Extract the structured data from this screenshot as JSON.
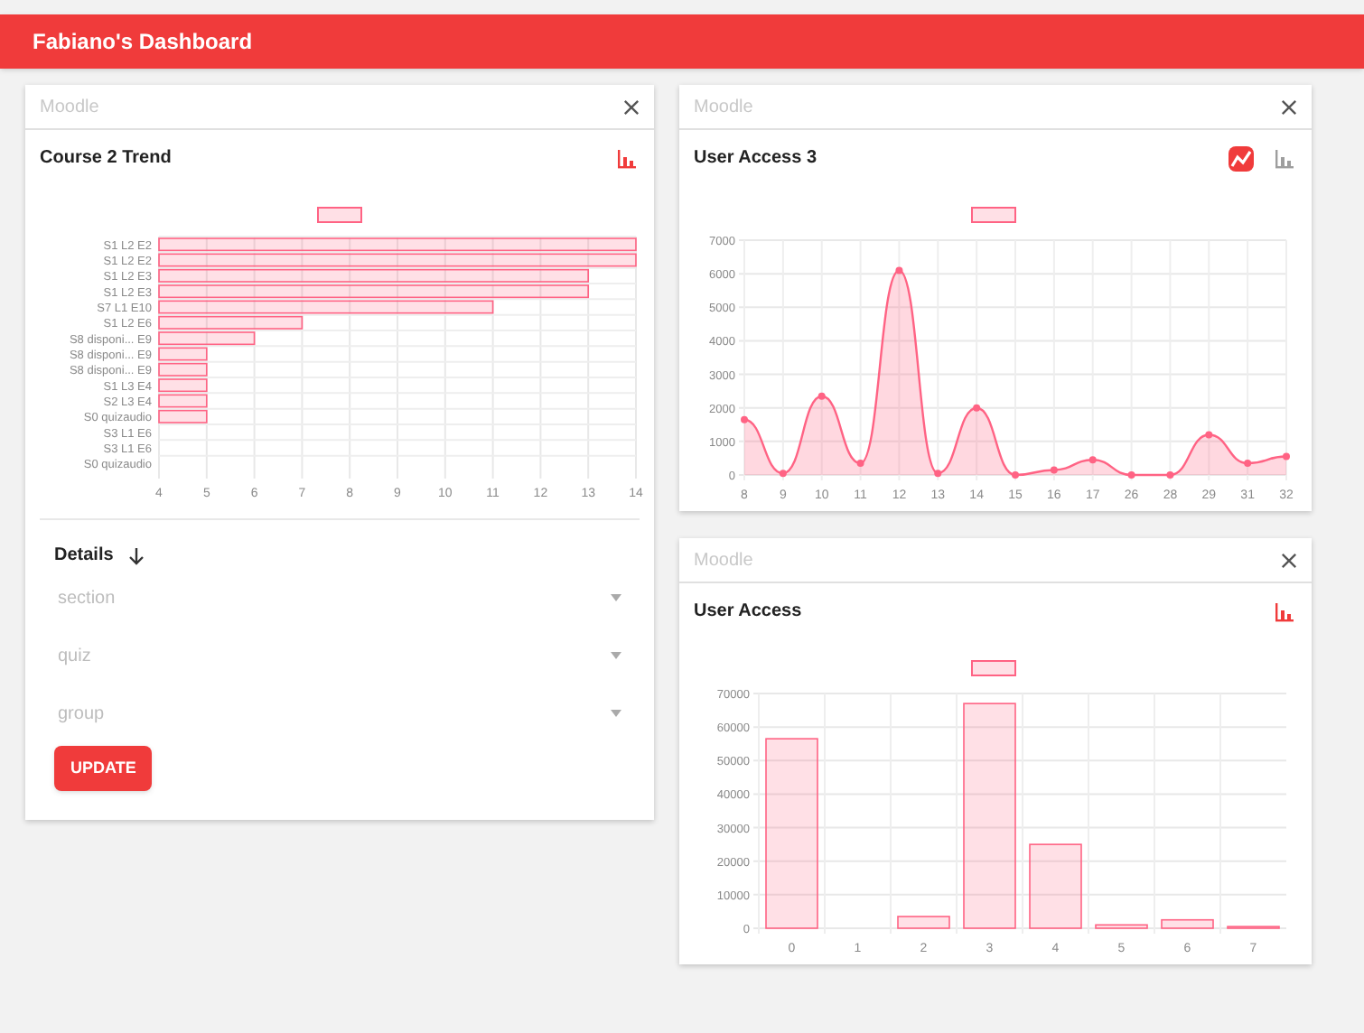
{
  "app_bar": {
    "title": "Fabiano's Dashboard"
  },
  "cards": [
    {
      "source": "Moodle",
      "title": "Course 2 Trend",
      "chart_buttons": [
        {
          "kind": "bar",
          "selected": true
        }
      ],
      "chart_data": {
        "type": "bar",
        "orientation": "horizontal",
        "categories": [
          "S1 L2 E2",
          "S1 L2 E2",
          "S1 L2 E3",
          "S1 L2 E3",
          "S7 L1 E10",
          "S1 L2 E6",
          "S8 disponi... E9",
          "S8 disponi... E9",
          "S8 disponi... E9",
          "S1 L3 E4",
          "S2 L3 E4",
          "S0 quizaudio",
          "S3 L1 E6",
          "S3 L1 E6",
          "S0 quizaudio"
        ],
        "grid": true,
        "series": [
          {
            "color": "#ff6384",
            "values": [
              14,
              14,
              13,
              13,
              11,
              7,
              6,
              5,
              5,
              5,
              5,
              5,
              null,
              null,
              null
            ]
          }
        ],
        "xlim": [
          4,
          14
        ],
        "xticks": [
          4,
          5,
          6,
          7,
          8,
          9,
          10,
          11,
          12,
          13,
          14
        ]
      },
      "details": {
        "label": "Details",
        "fields": [
          {
            "placeholder": "section"
          },
          {
            "placeholder": "quiz"
          },
          {
            "placeholder": "group"
          }
        ],
        "button": "UPDATE"
      }
    },
    {
      "source": "Moodle",
      "title": "User Access 3",
      "chart_buttons": [
        {
          "kind": "line",
          "selected": true
        },
        {
          "kind": "bar",
          "selected": false
        }
      ],
      "chart_data": {
        "type": "area",
        "categories": [
          "8",
          "9",
          "10",
          "11",
          "12",
          "13",
          "14",
          "15",
          "16",
          "17",
          "26",
          "28",
          "29",
          "31",
          "32"
        ],
        "grid": true,
        "series": [
          {
            "color": "#ff6384",
            "values": [
              1650,
              50,
              2350,
              350,
              6100,
              50,
              2000,
              0,
              150,
              450,
              0,
              0,
              1200,
              350,
              550
            ]
          }
        ],
        "ylim": [
          0,
          7000
        ],
        "yticks": [
          0,
          1000,
          2000,
          3000,
          4000,
          5000,
          6000,
          7000
        ]
      }
    },
    {
      "source": "Moodle",
      "title": "User Access",
      "chart_buttons": [
        {
          "kind": "bar",
          "selected": true
        }
      ],
      "chart_data": {
        "type": "bar",
        "categories": [
          "0",
          "1",
          "2",
          "3",
          "4",
          "5",
          "6",
          "7"
        ],
        "grid": true,
        "series": [
          {
            "color": "#ff6384",
            "values": [
              56500,
              0,
              3500,
              67000,
              25000,
              1000,
              2500,
              500
            ]
          }
        ],
        "ylim": [
          0,
          70000
        ],
        "yticks": [
          0,
          10000,
          20000,
          30000,
          40000,
          50000,
          60000,
          70000
        ]
      }
    }
  ]
}
